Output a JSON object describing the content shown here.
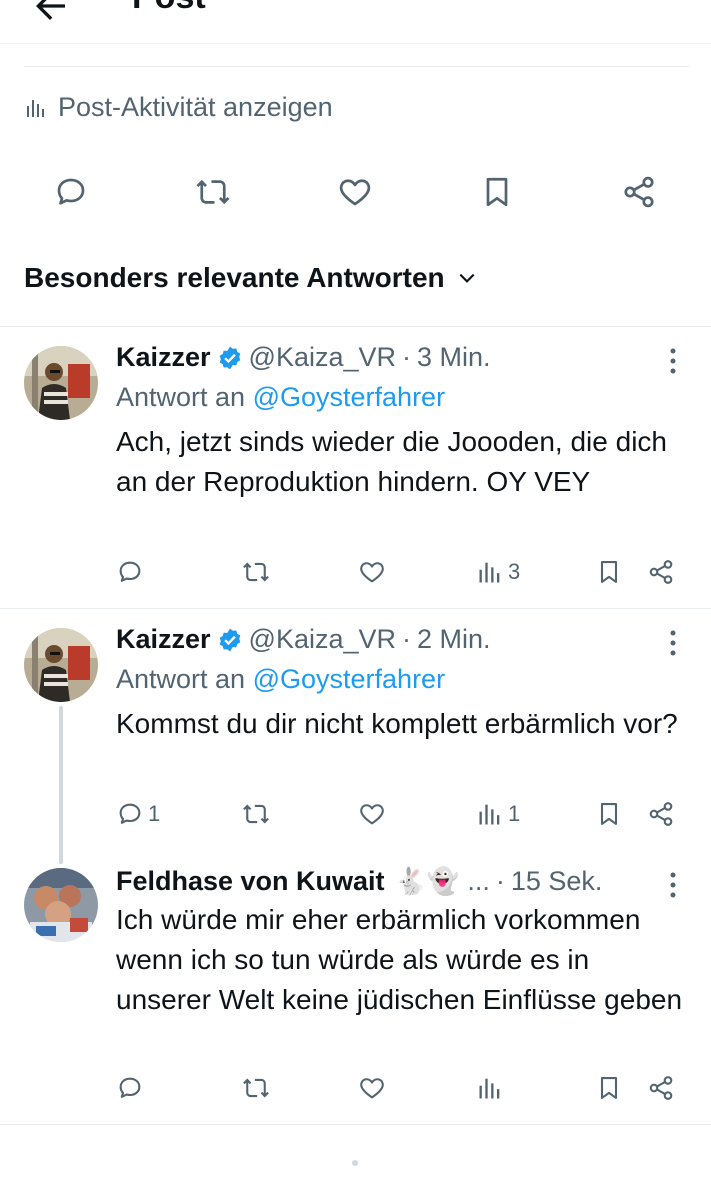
{
  "header": {
    "title": "Post"
  },
  "activity": {
    "label": "Post-Aktivität anzeigen"
  },
  "sort": {
    "label": "Besonders relevante Antworten"
  },
  "replies": [
    {
      "name": "Kaizzer",
      "handle": "@Kaiza_VR",
      "time": "3 Min.",
      "replying_prefix": "Antwort an",
      "replying_to": "@Goysterfahrer",
      "text": "Ach, jetzt sinds wieder die Joooden, die dich an der Reproduktion hindern. OY VEY",
      "reply_count": "",
      "views": "3"
    },
    {
      "name": "Kaizzer",
      "handle": "@Kaiza_VR",
      "time": "2 Min.",
      "replying_prefix": "Antwort an",
      "replying_to": "@Goysterfahrer",
      "text": "Kommst du dir nicht komplett erbärmlich vor?",
      "reply_count": "1",
      "views": "1"
    },
    {
      "name": "Feldhase von Kuwait",
      "emoji": "🐇👻",
      "ellipsis": "...",
      "time": "15 Sek.",
      "text": "Ich würde mir eher erbärmlich vorkommen wenn ich so tun würde als würde es in unserer Welt keine jüdischen Einflüsse geben",
      "reply_count": "",
      "views": ""
    }
  ],
  "separator": "·",
  "colors": {
    "accent": "#1d9bf0",
    "secondary": "#536471",
    "text": "#0f1419",
    "border": "#e7ebed"
  }
}
